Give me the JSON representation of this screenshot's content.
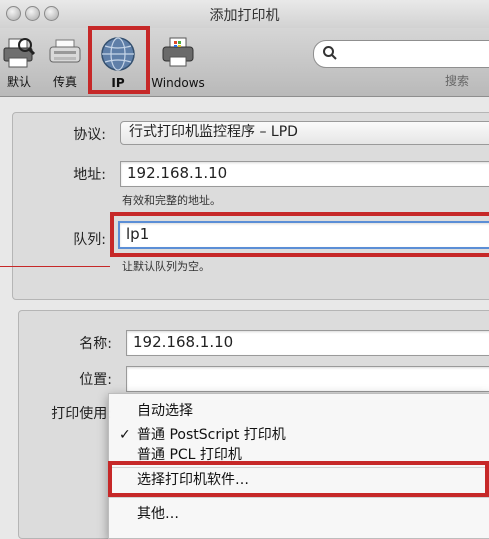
{
  "window": {
    "title": "添加打印机"
  },
  "toolbar": {
    "items": [
      {
        "label": "默认"
      },
      {
        "label": "传真"
      },
      {
        "label": "IP"
      },
      {
        "label": "Windows"
      }
    ],
    "search_label": "搜索"
  },
  "connection": {
    "protocol_label": "协议:",
    "protocol_value": "行式打印机监控程序 – LPD",
    "address_label": "地址:",
    "address_value": "192.168.1.10",
    "address_hint": "有效和完整的地址。",
    "queue_label": "队列:",
    "queue_value": "lp1",
    "queue_hint": "让默认队列为空。"
  },
  "printer": {
    "name_label": "名称:",
    "name_value": "192.168.1.10",
    "location_label": "位置:",
    "location_value": "",
    "use_label": "打印使用:"
  },
  "use_menu": {
    "items": [
      {
        "label": "自动选择",
        "checked": false
      },
      {
        "label": "普通 PostScript 打印机",
        "checked": true
      },
      {
        "label": "普通 PCL 打印机",
        "checked": false
      },
      {
        "label": "选择打印机软件…",
        "checked": false
      },
      {
        "label": "其他…",
        "checked": false
      }
    ],
    "checkmark": "✓"
  },
  "colors": {
    "highlight": "#c62828"
  }
}
